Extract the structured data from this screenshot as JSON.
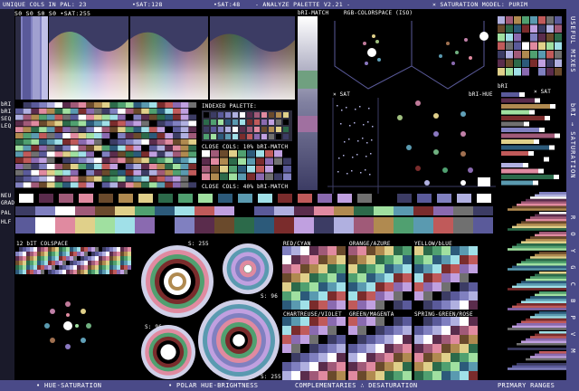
{
  "header": {
    "unique_cols": "UNIQUE COLS IN PAL: 23",
    "sat_list": "S0 S0 S0 S0 •SAT:255",
    "sat128": "•SAT:128",
    "sat48": "•SAT:48",
    "title": "- ANALYZE PALETTE V2.21 -",
    "sat_model": "× SATURATION MODEL: PURIM"
  },
  "labels": {
    "bri_match_top": "bRI-MATCH",
    "rgb_colorspace": "RGB-COLORSPACE (ISO)",
    "x_sat_left": "× SAT",
    "bri_hue": "bRI-HUE",
    "bri_right": "bRI",
    "x_sat_right": "× SAT",
    "useful_mixes": "USEFUL MIXES",
    "bri_saturation": "bRI → SATURATION",
    "roygcbpvm": "R O Y G C B P V M",
    "left_tags": [
      "bRI",
      "bRI",
      "SEQ",
      "LEQ"
    ],
    "indexed_palette": "INDEXED PALETTE:",
    "close_cols_10": "CLOSE COLS: 10% bRI-MATCH",
    "close_cols_40": "CLOSE COLS: 40% bRI-MATCH",
    "row_tags": [
      "NEU",
      "GRAD",
      "PAL",
      "HLF"
    ],
    "colspace12": "12 bIT COLSPACE",
    "s255_a": "S: 255",
    "s96_a": "S: 96",
    "s96_b": "S: 96",
    "s255_b": "S: 255",
    "red_cyan": "RED/CYAN",
    "orange_azure": "ORANGE/AZURE",
    "yellow_blue": "YELLOW/bLUE",
    "chartreuse_violet": "CHARTREUSE/VIOLET",
    "green_magenta": "GREEN/MAGENTA",
    "spring_rose": "SPRING-GREEN/ROSE"
  },
  "footer": {
    "hue_sat": "• HUE-SATURATION",
    "polar": "• POLAR HUE-BRIGHTNESS",
    "complementaries": "COMPLEMENTARIES ∴ DESATURATION",
    "primary": "PRIMARY RANGES"
  },
  "palette": [
    "#000000",
    "#3c3c64",
    "#5a5a9a",
    "#8080c0",
    "#b0b0e0",
    "#ffffff",
    "#5a2c4c",
    "#a05a78",
    "#e08aa0",
    "#6a4a2c",
    "#b08a50",
    "#e0d08a",
    "#2c6a4a",
    "#50a070",
    "#a0e0a0",
    "#2c5a7a",
    "#5a9ab0",
    "#a0e0e8",
    "#7a2c2c",
    "#c05a5a",
    "#8a6ab0",
    "#c0a0e0",
    "#707070"
  ],
  "colors": {
    "frame": "#4a4a88",
    "text": "#ffffff"
  }
}
